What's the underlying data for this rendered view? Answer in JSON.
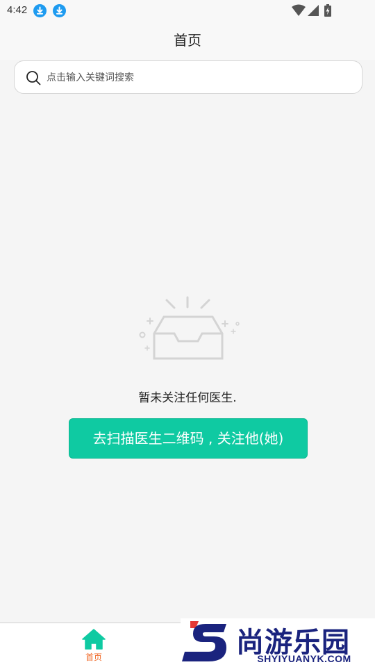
{
  "status_bar": {
    "time": "4:42",
    "notification_icons": [
      "download-icon",
      "download-icon"
    ],
    "system_icons": [
      "wifi-icon",
      "signal-icon",
      "battery-charging-icon"
    ]
  },
  "header": {
    "title": "首页"
  },
  "search": {
    "placeholder": "点击输入关键词搜索",
    "value": ""
  },
  "empty_state": {
    "icon": "empty-inbox-icon",
    "message": "暂未关注任何医生.",
    "action_label": "去扫描医生二维码 , 关注他(她)"
  },
  "bottom_nav": {
    "items": [
      {
        "label": "首页",
        "icon": "home-icon",
        "active": true
      }
    ]
  },
  "watermark": {
    "name": "尚游乐园",
    "url": "SHYIYUANYK.COM"
  },
  "colors": {
    "accent": "#0fcaa2",
    "nav_active_label": "#f06a28",
    "download_badge": "#1e9bf0",
    "watermark": "#1a237e"
  }
}
